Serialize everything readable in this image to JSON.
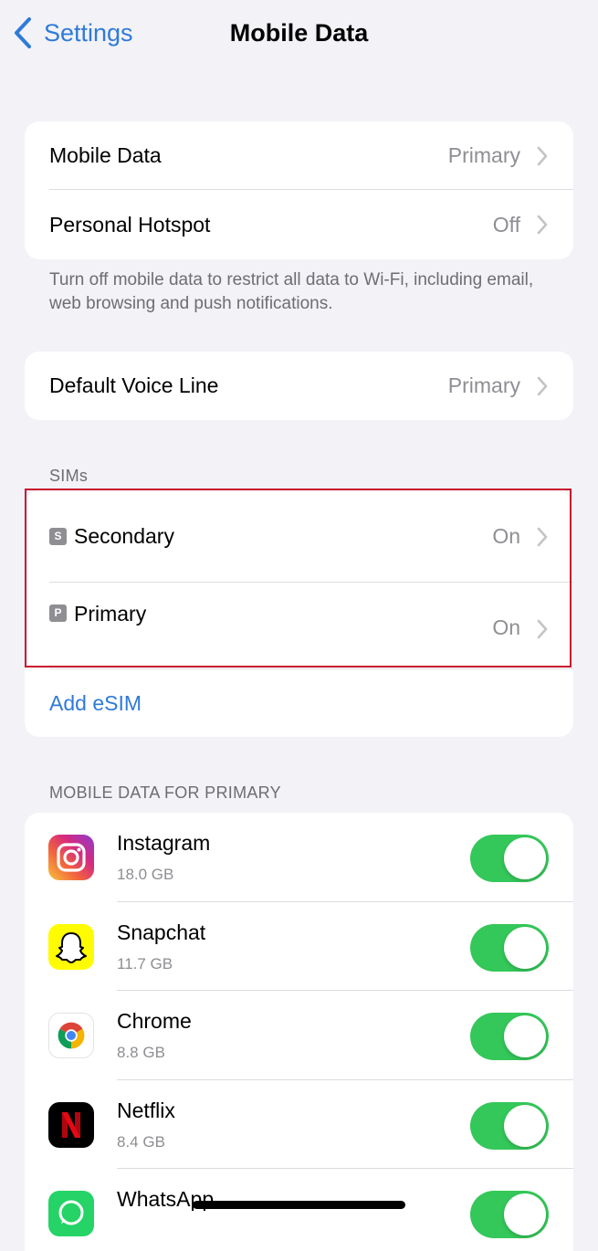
{
  "nav": {
    "back_label": "Settings",
    "title": "Mobile Data"
  },
  "data_group": {
    "rows": [
      {
        "label": "Mobile Data",
        "value": "Primary"
      },
      {
        "label": "Personal Hotspot",
        "value": "Off"
      }
    ]
  },
  "footnote": "Turn off mobile data to restrict all data to Wi-Fi, including email, web browsing and push notifications.",
  "voice_group": {
    "label": "Default Voice Line",
    "value": "Primary"
  },
  "sims": {
    "header": "SIMs",
    "items": [
      {
        "badge": "S",
        "label": "Secondary",
        "value": "On"
      },
      {
        "badge": "P",
        "label": "Primary",
        "value": "On"
      }
    ],
    "add_label": "Add eSIM"
  },
  "apps": {
    "header": "MOBILE DATA FOR PRIMARY",
    "items": [
      {
        "name": "Instagram",
        "size": "18.0 GB",
        "icon": "instagram-icon",
        "enabled": true
      },
      {
        "name": "Snapchat",
        "size": "11.7 GB",
        "icon": "snapchat-icon",
        "enabled": true
      },
      {
        "name": "Chrome",
        "size": "8.8 GB",
        "icon": "chrome-icon",
        "enabled": true
      },
      {
        "name": "Netflix",
        "size": "8.4 GB",
        "icon": "netflix-icon",
        "enabled": true
      },
      {
        "name": "WhatsApp",
        "size": "",
        "icon": "whatsapp-icon",
        "enabled": true
      }
    ]
  },
  "colors": {
    "accent": "#2f7ad8",
    "toggle_on": "#34c759",
    "highlight": "#c8102e",
    "background": "#f2f2f7"
  }
}
